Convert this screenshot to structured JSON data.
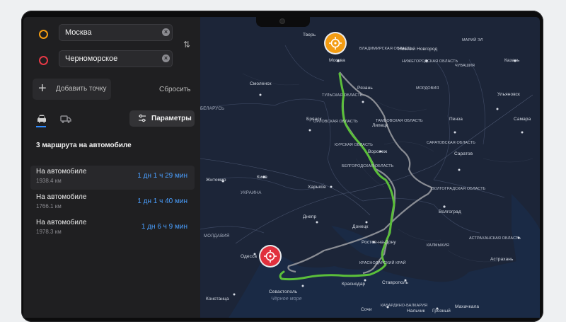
{
  "route_inputs": {
    "from": "Москва",
    "to": "Черноморское",
    "add_point": "Добавить точку",
    "reset": "Сбросить"
  },
  "transport_modes": [
    "car-icon",
    "truck-icon"
  ],
  "params_button": "Параметры",
  "routes_title": "3 маршрута на автомобиле",
  "routes": [
    {
      "name": "На автомобиле",
      "distance": "1938.4 км",
      "time": "1 дн 1 ч 29 мин"
    },
    {
      "name": "На автомобиле",
      "distance": "1766.1 км",
      "time": "1 дн 1 ч 40 мин"
    },
    {
      "name": "На автомобиле",
      "distance": "1978.3 км",
      "time": "1 дн 6 ч 9 мин"
    }
  ],
  "map_labels": {
    "tver": "Тверь",
    "moscow": "Москва",
    "vladimir_obl": "ВЛАДИМИРСКАЯ ОБЛАСТЬ",
    "nizhny": "Нижний Новгород",
    "mariy_el": "МАРИЙ ЭЛ",
    "nizhegorod_obl": "НИЖЕГОРОДСКАЯ ОБЛАСТЬ",
    "kazan": "Казань",
    "chuvashia": "ЧУВАШИЯ",
    "ryazan": "Рязань",
    "smolensk": "Смоленск",
    "tula_obl": "ТУЛЬСКАЯ ОБЛАСТЬ",
    "mordovia": "МОРДОВИЯ",
    "ulyanovsk": "Ульяновск",
    "belarus": "БЕЛАРУСЬ",
    "tambov_obl": "ТАМБОВСКАЯ ОБЛАСТЬ",
    "penza": "Пенза",
    "samara": "Самара",
    "bryansk": "Брянск",
    "oryol_obl": "ОРЛОВСКАЯ ОБЛАСТЬ",
    "lipetsk": "Липецк",
    "saratov_obl": "САРАТОВСКАЯ ОБЛАСТЬ",
    "kursk_obl": "КУРСКАЯ ОБЛАСТЬ",
    "voronezh": "Воронеж",
    "saratov": "Саратов",
    "belgorod_obl": "БЕЛГОРОДСКАЯ ОБЛАСТЬ",
    "zhytomyr": "Житомир",
    "kyiv": "Киев",
    "kharkiv": "Харьков",
    "volgograd_obl": "ВОЛГОГРАДСКАЯ ОБЛАСТЬ",
    "ukraine": "УКРАИНА",
    "volgograd": "Волгоград",
    "dnipro": "Днепр",
    "donetsk": "Донецк",
    "moldova": "МОЛДАВИЯ",
    "rostov": "Ростов-на-Дону",
    "astrakhan_obl": "АСТРАХАНСКАЯ ОБЛАСТЬ",
    "kalmykia": "КАЛМЫКИЯ",
    "astrakhan": "Астрахань",
    "odessa": "Одесса",
    "krasnodar_krai": "КРАСНОДАРСКИЙ КРАЙ",
    "krasnodar": "Краснодар",
    "stavropol": "Ставрополь",
    "sevastopol": "Севастополь",
    "black_sea": "Чёрное море",
    "constanta": "Констанца",
    "sochi": "Сочи",
    "kabardino": "КАБАРДИНО-БАЛКАРИЯ",
    "nalchik": "Нальчик",
    "grozny": "Грозный",
    "makhachkala": "Махачкала"
  },
  "colors": {
    "selected_route": "#5bbf3a",
    "alt_route": "#8a8d94",
    "time": "#4a9fff",
    "start_pin": "#f39c12",
    "end_pin": "#e1303d"
  }
}
